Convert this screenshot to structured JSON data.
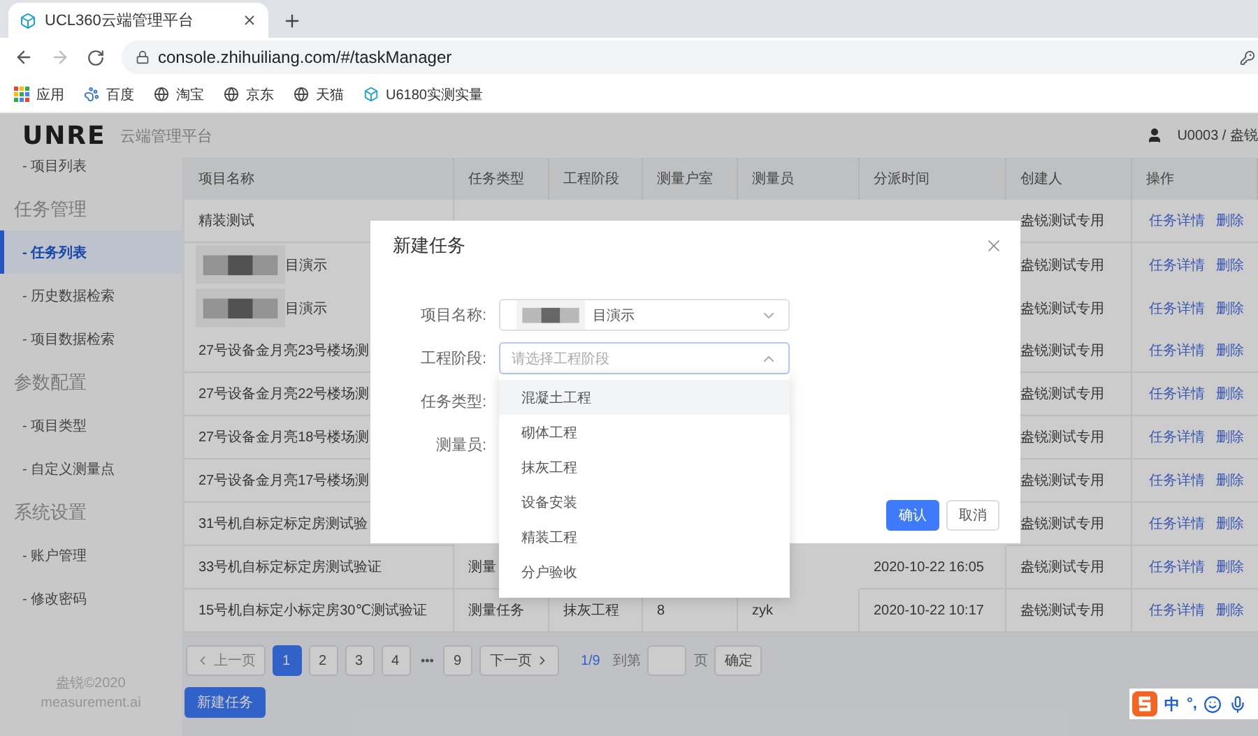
{
  "browser": {
    "tab": {
      "title": "UCL360云端管理平台"
    },
    "address": "console.zhihuiliang.com/#/taskManager",
    "bookmarks": [
      {
        "kind": "apps",
        "label": "应用"
      },
      {
        "kind": "paw",
        "label": "百度"
      },
      {
        "kind": "globe",
        "label": "淘宝"
      },
      {
        "kind": "globe",
        "label": "京东"
      },
      {
        "kind": "globe",
        "label": "天猫"
      },
      {
        "kind": "cube",
        "label": "U6180实测实量"
      }
    ]
  },
  "header": {
    "logo": "UNRE",
    "subtitle": "云端管理平台",
    "user": "U0003 / 盎锐"
  },
  "sidebar": {
    "groups": [
      {
        "items": [
          {
            "label": "- 项目列表",
            "selected": false
          }
        ]
      },
      {
        "heading": "任务管理",
        "items": [
          {
            "label": "- 任务列表",
            "selected": true
          },
          {
            "label": "- 历史数据检索",
            "selected": false
          },
          {
            "label": "- 项目数据检索",
            "selected": false
          }
        ]
      },
      {
        "heading": "参数配置",
        "items": [
          {
            "label": "- 项目类型",
            "selected": false
          },
          {
            "label": "- 自定义测量点",
            "selected": false
          }
        ]
      },
      {
        "heading": "系统设置",
        "items": [
          {
            "label": "- 账户管理",
            "selected": false
          },
          {
            "label": "- 修改密码",
            "selected": false
          }
        ]
      }
    ],
    "footer": [
      "盎锐©2020",
      "measurement.ai"
    ]
  },
  "table": {
    "columns": [
      "项目名称",
      "任务类型",
      "工程阶段",
      "测量户室",
      "测量员",
      "分派时间",
      "创建人",
      "操作"
    ],
    "rows": [
      {
        "name": "精装测试",
        "redacted": false,
        "creator": "盎锐测试专用",
        "actions": [
          "任务详情",
          "删除"
        ]
      },
      {
        "name": "目演示",
        "redacted": true,
        "creator": "盎锐测试专用",
        "actions": [
          "任务详情",
          "删除"
        ]
      },
      {
        "name": "目演示",
        "redacted": true,
        "creator": "盎锐测试专用",
        "actions": [
          "任务详情",
          "删除"
        ]
      },
      {
        "name": "27号设备金月亮23号楼场测",
        "redacted": false,
        "creator": "盎锐测试专用",
        "actions": [
          "任务详情",
          "删除"
        ]
      },
      {
        "name": "27号设备金月亮22号楼场测",
        "redacted": false,
        "creator": "盎锐测试专用",
        "actions": [
          "任务详情",
          "删除"
        ]
      },
      {
        "name": "27号设备金月亮18号楼场测",
        "redacted": false,
        "creator": "盎锐测试专用",
        "actions": [
          "任务详情",
          "删除"
        ]
      },
      {
        "name": "27号设备金月亮17号楼场测",
        "redacted": false,
        "creator": "盎锐测试专用",
        "actions": [
          "任务详情",
          "删除"
        ]
      },
      {
        "name": "31号机自标定标定房测试验",
        "redacted": false,
        "creator": "盎锐测试专用",
        "actions": [
          "任务详情",
          "删除"
        ]
      },
      {
        "name": "33号机自标定标定房测试验证",
        "redacted": false,
        "type": "测量",
        "time": "2020-10-22 16:05",
        "creator": "盎锐测试专用",
        "actions": [
          "任务详情",
          "删除"
        ]
      },
      {
        "name": "15号机自标定小标定房30℃测试验证",
        "redacted": false,
        "type": "测量任务",
        "stage": "抹灰工程",
        "rooms": "8",
        "surveyor": "zyk",
        "time": "2020-10-22 10:17",
        "creator": "盎锐测试专用",
        "actions": [
          "任务详情",
          "删除"
        ]
      }
    ]
  },
  "pagination": {
    "prev": {
      "label": "上一页",
      "disabled": true
    },
    "pages": [
      {
        "kind": "page",
        "label": "1",
        "selected": true
      },
      {
        "kind": "page",
        "label": "2",
        "selected": false
      },
      {
        "kind": "page",
        "label": "3",
        "selected": false
      },
      {
        "kind": "page",
        "label": "4",
        "selected": false
      },
      {
        "kind": "ellipsis",
        "label": "•••",
        "selected": false
      },
      {
        "kind": "page",
        "label": "9",
        "selected": false
      }
    ],
    "next": {
      "label": "下一页",
      "disabled": false
    },
    "summary": "1/9",
    "goto_prefix": "到第",
    "goto_suffix": "页",
    "goto_button": "确定"
  },
  "new_task_button": "新建任务",
  "modal": {
    "title": "新建任务",
    "fields": [
      {
        "kind": "select",
        "label": "项目名称:",
        "value": "目演示",
        "redacted": true,
        "expanded": false
      },
      {
        "kind": "select",
        "label": "工程阶段:",
        "placeholder": "请选择工程阶段",
        "redacted": false,
        "expanded": true,
        "options": [
          {
            "label": "混凝土工程",
            "hovered": true
          },
          {
            "label": "砌体工程",
            "hovered": false
          },
          {
            "label": "抹灰工程",
            "hovered": false
          },
          {
            "label": "设备安装",
            "hovered": false
          },
          {
            "label": "精装工程",
            "hovered": false
          },
          {
            "label": "分户验收",
            "hovered": false
          }
        ]
      },
      {
        "kind": "covered",
        "label": "任务类型:"
      },
      {
        "kind": "covered",
        "label": "测量员:"
      }
    ],
    "buttons": [
      {
        "label": "确认",
        "primary": true
      },
      {
        "label": "取消",
        "primary": false
      }
    ]
  },
  "ime": {
    "mode": "中",
    "punctuation": "°,"
  }
}
